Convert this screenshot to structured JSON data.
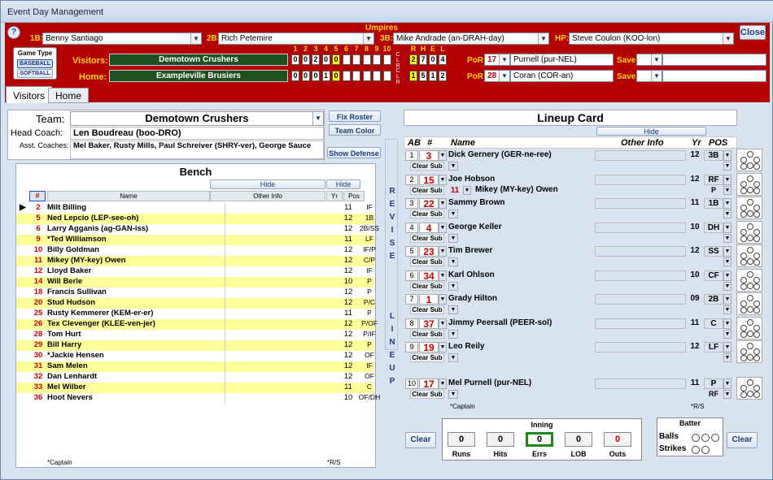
{
  "window": {
    "title": "Event Day Management",
    "close_label": "Close"
  },
  "umpires": {
    "header": "Umpires",
    "b1_label": "1B:",
    "b1": "Benny Santiago",
    "b2_label": "2B:",
    "b2": "Rich Petemire",
    "b3_label": "3B:",
    "b3": "Mike Andrade (an-DRAH-day)",
    "hp_label": "HP:",
    "hp": "Steve Coulon (KOO-lon)"
  },
  "game_type": {
    "label": "Game Type",
    "baseball": "BASEBALL",
    "softball": "SOFTBALL"
  },
  "score": {
    "visitors_label": "Visitors:",
    "home_label": "Home:",
    "visitors_team": "Demotown Crushers",
    "home_team": "Exampleville Brusiers",
    "innings": [
      "1",
      "2",
      "3",
      "4",
      "5",
      "6",
      "7",
      "8",
      "9",
      "10"
    ],
    "visitors_inn": [
      "0",
      "0",
      "2",
      "0",
      "0",
      "",
      "",
      "",
      "",
      ""
    ],
    "home_inn": [
      "0",
      "0",
      "0",
      "1",
      "0",
      "",
      "",
      "",
      "",
      ""
    ],
    "clr": "C L R",
    "rhel_headers": [
      "R",
      "H",
      "E",
      "L"
    ],
    "visitors_rhel": [
      "2",
      "7",
      "0",
      "4"
    ],
    "home_rhel": [
      "1",
      "5",
      "1",
      "2"
    ],
    "por_label": "PoR:",
    "save_label": "Save:",
    "v_por_num": "17",
    "v_por": "Purnell (pur-NEL)",
    "h_por_num": "28",
    "h_por": "Coran (COR-an)"
  },
  "tabs": [
    "Visitors",
    "Home"
  ],
  "team": {
    "team_label": "Team:",
    "team_name": "Demotown Crushers",
    "coach_label": "Head Coach:",
    "coach": "Len Boudreau (boo-DRO)",
    "asst_label": "Asst. Coaches:",
    "asst": "Mel Baker, Rusty Mills, Paul Schreiver (SHRY-ver), George Sauce",
    "fix_roster": "Fix Roster",
    "team_color": "Team Color",
    "show_defense": "Show Defense"
  },
  "bench": {
    "title": "Bench",
    "hide": "Hide",
    "hide2": "Hide",
    "col_num": "#",
    "col_name": "Name",
    "col_other": "Other Info",
    "col_yr": "Yr",
    "col_pos": "Pos",
    "captain_note": "*Captain",
    "rs_note": "*R/S",
    "rows": [
      {
        "n": "2",
        "name": "Milt Billing",
        "yr": "11",
        "pos": "IF",
        "hl": false
      },
      {
        "n": "5",
        "name": "Ned Lepcio (LEP-see-oh)",
        "yr": "12",
        "pos": "1B",
        "hl": true
      },
      {
        "n": "6",
        "name": "Larry Agganis (ag-GAN-iss)",
        "yr": "12",
        "pos": "2B/SS",
        "hl": false
      },
      {
        "n": "9",
        "name": "*Ted Williamson",
        "yr": "11",
        "pos": "LF",
        "hl": true
      },
      {
        "n": "10",
        "name": "Billy Goldman",
        "yr": "12",
        "pos": "IF/P",
        "hl": false
      },
      {
        "n": "11",
        "name": "Mikey (MY-key) Owen",
        "yr": "12",
        "pos": "C/P",
        "hl": true
      },
      {
        "n": "12",
        "name": "Lloyd Baker",
        "yr": "12",
        "pos": "IF",
        "hl": false
      },
      {
        "n": "14",
        "name": "Will Berle",
        "yr": "10",
        "pos": "P",
        "hl": true
      },
      {
        "n": "18",
        "name": "Francis Sullivan",
        "yr": "12",
        "pos": "P",
        "hl": false
      },
      {
        "n": "20",
        "name": "Stud Hudson",
        "yr": "12",
        "pos": "P/C",
        "hl": true
      },
      {
        "n": "25",
        "name": "Rusty Kemmerer (KEM-er-er)",
        "yr": "11",
        "pos": "P",
        "hl": false
      },
      {
        "n": "26",
        "name": "Tex Clevenger (KLEE-ven-jer)",
        "yr": "12",
        "pos": "P/OF",
        "hl": true
      },
      {
        "n": "28",
        "name": "Tom Hurt",
        "yr": "12",
        "pos": "P/IF",
        "hl": false
      },
      {
        "n": "29",
        "name": "Bill Harry",
        "yr": "12",
        "pos": "P",
        "hl": true
      },
      {
        "n": "30",
        "name": "*Jackie Hensen",
        "yr": "12",
        "pos": "OF",
        "hl": false
      },
      {
        "n": "31",
        "name": "Sam Melen",
        "yr": "12",
        "pos": "IF",
        "hl": true
      },
      {
        "n": "32",
        "name": "Dan Lenhardt",
        "yr": "12",
        "pos": "OF",
        "hl": false
      },
      {
        "n": "33",
        "name": "Mel Wilber",
        "yr": "11",
        "pos": "C",
        "hl": true
      },
      {
        "n": "36",
        "name": "Hoot Nevers",
        "yr": "10",
        "pos": "OF/DH",
        "hl": false
      }
    ]
  },
  "revise": [
    "R",
    "E",
    "V",
    "I",
    "S",
    "E",
    "L",
    "I",
    "N",
    "E",
    "U",
    "P"
  ],
  "lineup": {
    "title": "Lineup Card",
    "hide": "Hide",
    "col_ab": "AB",
    "col_num": "#",
    "col_name": "Name",
    "col_other": "Other Info",
    "col_yr": "Yr",
    "col_pos": "POS",
    "clear_sub": "Clear Sub",
    "captain_note": "*Captain",
    "rs_note": "*R/S",
    "rows": [
      {
        "ab": "1",
        "n": "3",
        "name": "Dick Gernery (GER-ne-ree)",
        "yr": "12",
        "pos": "3B",
        "sub_n": "",
        "sub": "",
        "sub_pos": ""
      },
      {
        "ab": "2",
        "n": "15",
        "name": "Joe Hobson",
        "yr": "12",
        "pos": "RF",
        "sub_n": "11",
        "sub": "Mikey (MY-key) Owen",
        "sub_pos": "P"
      },
      {
        "ab": "3",
        "n": "22",
        "name": "Sammy Brown",
        "yr": "11",
        "pos": "1B",
        "sub_n": "",
        "sub": "",
        "sub_pos": ""
      },
      {
        "ab": "4",
        "n": "4",
        "name": "George Keller",
        "yr": "10",
        "pos": "DH",
        "sub_n": "",
        "sub": "",
        "sub_pos": ""
      },
      {
        "ab": "5",
        "n": "23",
        "name": "Tim Brewer",
        "yr": "12",
        "pos": "SS",
        "sub_n": "",
        "sub": "",
        "sub_pos": ""
      },
      {
        "ab": "6",
        "n": "34",
        "name": "Karl Ohlson",
        "yr": "10",
        "pos": "CF",
        "sub_n": "",
        "sub": "",
        "sub_pos": ""
      },
      {
        "ab": "7",
        "n": "1",
        "name": "Grady Hilton",
        "yr": "09",
        "pos": "2B",
        "sub_n": "",
        "sub": "",
        "sub_pos": ""
      },
      {
        "ab": "8",
        "n": "37",
        "name": "Jimmy Peersall (PEER-sol)",
        "yr": "11",
        "pos": "C",
        "sub_n": "",
        "sub": "",
        "sub_pos": ""
      },
      {
        "ab": "9",
        "n": "19",
        "name": "Leo Reily",
        "yr": "12",
        "pos": "LF",
        "sub_n": "",
        "sub": "",
        "sub_pos": ""
      },
      {
        "ab": "10",
        "n": "17",
        "name": "Mel Purnell (pur-NEL)",
        "yr": "11",
        "pos": "P",
        "sub_n": "",
        "sub": "",
        "sub_pos": "RF"
      }
    ]
  },
  "inning": {
    "title": "Inning",
    "clear": "Clear",
    "clear2": "Clear",
    "labels": [
      "Runs",
      "Hits",
      "Errs",
      "LOB",
      "Outs"
    ],
    "values": [
      "0",
      "0",
      "0",
      "0",
      "0"
    ]
  },
  "batter": {
    "title": "Batter",
    "balls": "Balls",
    "strikes": "Strikes"
  }
}
